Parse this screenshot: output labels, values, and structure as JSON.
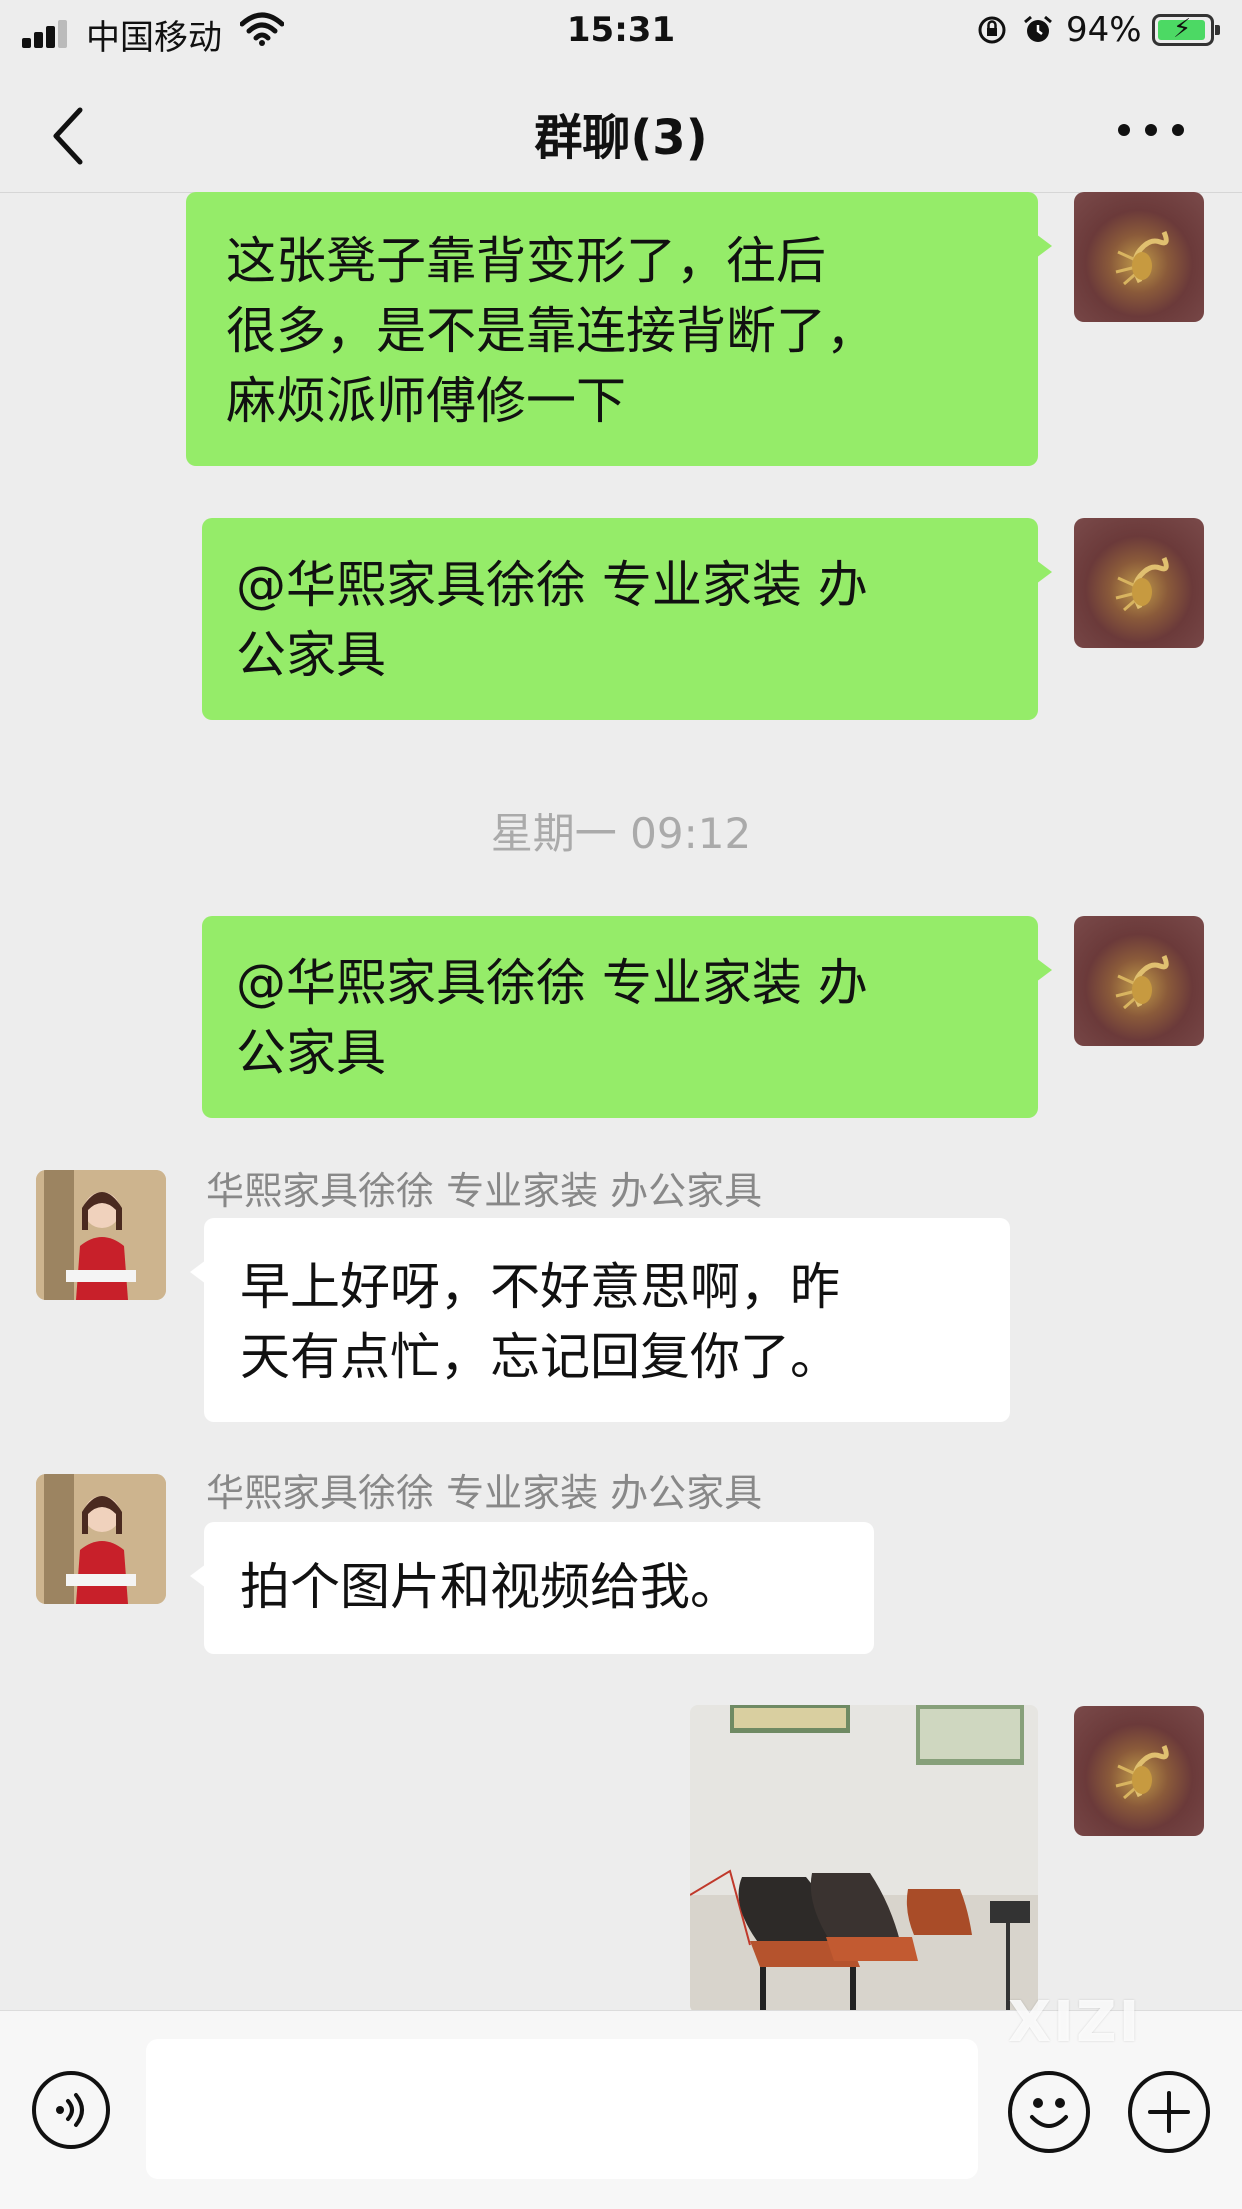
{
  "status_bar": {
    "carrier": "中国移动",
    "time": "15:31",
    "battery_percent": "94%",
    "battery_level": 0.94,
    "icons": [
      "signal-icon",
      "wifi-icon",
      "orientation-lock-icon",
      "alarm-icon",
      "battery-charging-icon"
    ]
  },
  "nav": {
    "title": "群聊(3)",
    "back_icon": "chevron-left-icon",
    "more_icon": "more-dots-icon"
  },
  "messages": [
    {
      "from": "me",
      "text": "这张凳子靠背变形了，往后\n很多，是不是靠连接背断了，\n麻烦派师傅修一下"
    },
    {
      "from": "me",
      "text": "@华熙家具徐徐 专业家装 办\n公家具"
    },
    {
      "timestamp": "星期一 09:12"
    },
    {
      "from": "me",
      "text": "@华熙家具徐徐 专业家装 办\n公家具"
    },
    {
      "from": "them",
      "sender": "华熙家具徐徐 专业家装 办公家具",
      "text": "早上好呀，不好意思啊，昨\n天有点忙，忘记回复你了。"
    },
    {
      "from": "them",
      "sender": "华熙家具徐徐 专业家装 办公家具",
      "text": "拍个图片和视频给我。"
    },
    {
      "from": "me",
      "type": "image"
    }
  ],
  "input_bar": {
    "placeholder": "",
    "voice_icon": "voice-icon",
    "emoji_icon": "emoji-icon",
    "plus_icon": "plus-icon"
  },
  "watermark": "XIZI",
  "colors": {
    "background": "#ededed",
    "my_bubble": "#95ec69",
    "their_bubble": "#ffffff",
    "sender_name": "#888888",
    "timestamp": "#aaaaaa"
  }
}
